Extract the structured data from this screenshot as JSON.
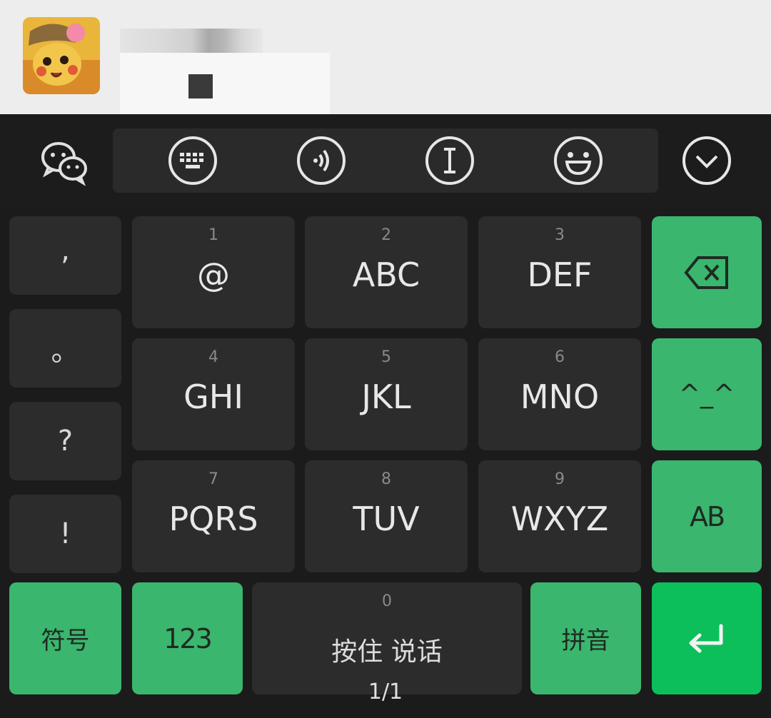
{
  "toolbar": {
    "icons": [
      "wechat-logo-icon",
      "keyboard-icon",
      "voice-icon",
      "text-cursor-icon",
      "emoji-icon",
      "collapse-chevron-icon"
    ]
  },
  "keyboard": {
    "punctuation": [
      ",",
      "。",
      "?",
      "!"
    ],
    "keys": [
      {
        "digit": "1",
        "letters": "@"
      },
      {
        "digit": "2",
        "letters": "ABC"
      },
      {
        "digit": "3",
        "letters": "DEF"
      },
      {
        "digit": "4",
        "letters": "GHI"
      },
      {
        "digit": "5",
        "letters": "JKL"
      },
      {
        "digit": "6",
        "letters": "MNO"
      },
      {
        "digit": "7",
        "letters": "PQRS"
      },
      {
        "digit": "8",
        "letters": "TUV"
      },
      {
        "digit": "9",
        "letters": "WXYZ"
      }
    ],
    "emoticon_label": "^_^",
    "case_label": "AB",
    "symbols_label": "符号",
    "numbers_label": "123",
    "space_digit": "0",
    "space_label": "按住 说话",
    "pinyin_label": "拼音",
    "page_indicator": "1/1"
  },
  "colors": {
    "accent": "#3ab66e",
    "enter": "#0dbf5b",
    "key": "#2c2c2c",
    "background": "#1b1b1b"
  }
}
